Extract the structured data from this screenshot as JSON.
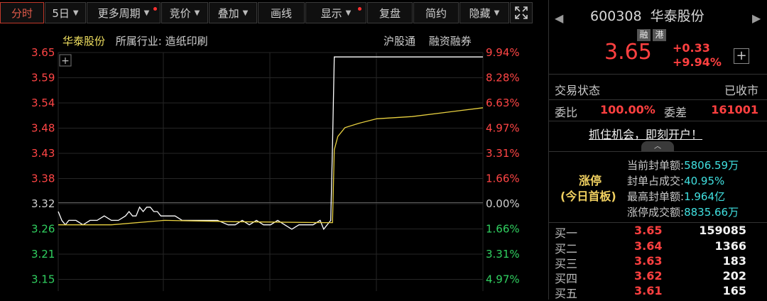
{
  "toolbar": {
    "items": [
      {
        "label": "分时",
        "active": true
      },
      {
        "label": "5日",
        "caret": true
      },
      {
        "label": "更多周期",
        "caret": true,
        "dot": true
      },
      {
        "label": "竞价",
        "caret": true
      },
      {
        "label": "叠加",
        "caret": true
      },
      {
        "label": "画线"
      },
      {
        "label": "显示",
        "caret": true,
        "dot": true
      },
      {
        "label": "复盘"
      },
      {
        "label": "简约"
      },
      {
        "label": "隐藏",
        "caret": true
      }
    ],
    "fullscreen_icon": "expand-icon"
  },
  "chart_info": {
    "stock_name": "华泰股份",
    "industry": "所属行业: 造纸印刷",
    "tag1": "沪股通",
    "tag2": "融资融券"
  },
  "chart_data": {
    "type": "line",
    "title": "",
    "prev_close": 3.32,
    "ylim": [
      3.12,
      3.66
    ],
    "left_ticks": [
      "3.65",
      "3.59",
      "3.54",
      "3.48",
      "3.43",
      "3.38",
      "3.32",
      "3.26",
      "3.21",
      "3.15"
    ],
    "right_ticks": [
      "9.94%",
      "8.28%",
      "6.63%",
      "4.97%",
      "3.31%",
      "1.66%",
      "0.00%",
      "1.66%",
      "3.31%",
      "4.97%"
    ],
    "x_minutes": [
      0,
      240
    ],
    "series": [
      {
        "color": "#ffffff",
        "points": [
          [
            0,
            3.3
          ],
          [
            2,
            3.28
          ],
          [
            4,
            3.27
          ],
          [
            6,
            3.28
          ],
          [
            10,
            3.28
          ],
          [
            14,
            3.27
          ],
          [
            18,
            3.28
          ],
          [
            22,
            3.28
          ],
          [
            26,
            3.29
          ],
          [
            30,
            3.28
          ],
          [
            34,
            3.28
          ],
          [
            38,
            3.29
          ],
          [
            40,
            3.3
          ],
          [
            42,
            3.29
          ],
          [
            44,
            3.29
          ],
          [
            46,
            3.31
          ],
          [
            48,
            3.3
          ],
          [
            50,
            3.31
          ],
          [
            52,
            3.31
          ],
          [
            54,
            3.3
          ],
          [
            56,
            3.3
          ],
          [
            58,
            3.29
          ],
          [
            62,
            3.29
          ],
          [
            66,
            3.29
          ],
          [
            70,
            3.28
          ],
          [
            74,
            3.28
          ],
          [
            78,
            3.28
          ],
          [
            82,
            3.28
          ],
          [
            86,
            3.28
          ],
          [
            90,
            3.28
          ],
          [
            96,
            3.27
          ],
          [
            100,
            3.27
          ],
          [
            104,
            3.28
          ],
          [
            108,
            3.27
          ],
          [
            112,
            3.28
          ],
          [
            116,
            3.27
          ],
          [
            120,
            3.27
          ],
          [
            124,
            3.28
          ],
          [
            128,
            3.27
          ],
          [
            132,
            3.26
          ],
          [
            136,
            3.27
          ],
          [
            140,
            3.27
          ],
          [
            144,
            3.27
          ],
          [
            148,
            3.28
          ],
          [
            150,
            3.26
          ],
          [
            152,
            3.27
          ],
          [
            154,
            3.28
          ],
          [
            155,
            3.45
          ],
          [
            156,
            3.65
          ],
          [
            200,
            3.65
          ],
          [
            240,
            3.65
          ]
        ]
      },
      {
        "color": "#e8d040",
        "points": [
          [
            0,
            3.27
          ],
          [
            30,
            3.27
          ],
          [
            60,
            3.28
          ],
          [
            100,
            3.277
          ],
          [
            150,
            3.275
          ],
          [
            155,
            3.275
          ],
          [
            156,
            3.44
          ],
          [
            158,
            3.47
          ],
          [
            162,
            3.49
          ],
          [
            170,
            3.5
          ],
          [
            180,
            3.51
          ],
          [
            200,
            3.515
          ],
          [
            220,
            3.525
          ],
          [
            240,
            3.535
          ]
        ]
      }
    ]
  },
  "panel": {
    "code": "600308",
    "name": "华泰股份",
    "tags": [
      "融",
      "港"
    ],
    "price": "3.65",
    "change": "+0.33",
    "change_pct": "+9.94%",
    "status_label": "交易状态",
    "status_value": "已收市",
    "weibi_label": "委比",
    "weibi_value": "100.00%",
    "weicha_label": "委差",
    "weicha_value": "161001",
    "promo": "抓住机会，即刻开户！",
    "limit_up_title": "涨停",
    "limit_up_sub": "(今日首板)",
    "seal_stats": [
      {
        "label": "当前封单额:",
        "value": "5806.59万"
      },
      {
        "label": "封单占成交:",
        "value": "40.95%"
      },
      {
        "label": "最高封单额:",
        "value": "1.964亿"
      },
      {
        "label": "涨停成交额:",
        "value": "8835.66万"
      }
    ],
    "bids": [
      {
        "name": "买一",
        "price": "3.65",
        "vol": "159085"
      },
      {
        "name": "买二",
        "price": "3.64",
        "vol": "1366"
      },
      {
        "name": "买三",
        "price": "3.63",
        "vol": "183"
      },
      {
        "name": "买四",
        "price": "3.62",
        "vol": "202"
      },
      {
        "name": "买五",
        "price": "3.61",
        "vol": "165"
      }
    ]
  }
}
